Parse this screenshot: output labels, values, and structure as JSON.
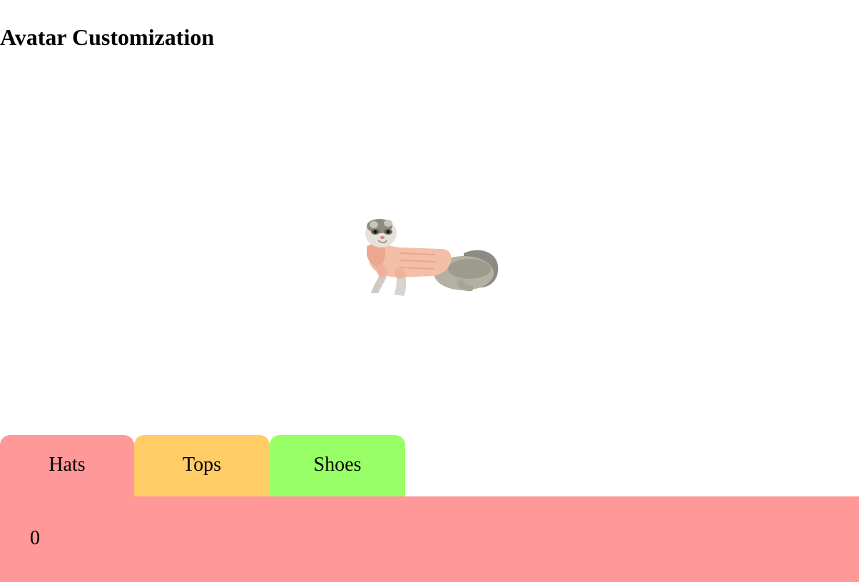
{
  "page": {
    "title": "Avatar Customization"
  },
  "avatar": {
    "icon": "ferret-in-sweater-icon",
    "sweater_color": "#f4bfa8"
  },
  "tabs": [
    {
      "label": "Hats",
      "color": "#ff9999",
      "selected": true
    },
    {
      "label": "Tops",
      "color": "#ffcc66",
      "selected": false
    },
    {
      "label": "Shoes",
      "color": "#99ff66",
      "selected": false
    }
  ],
  "panel": {
    "value": "0",
    "color": "#ff9999"
  }
}
